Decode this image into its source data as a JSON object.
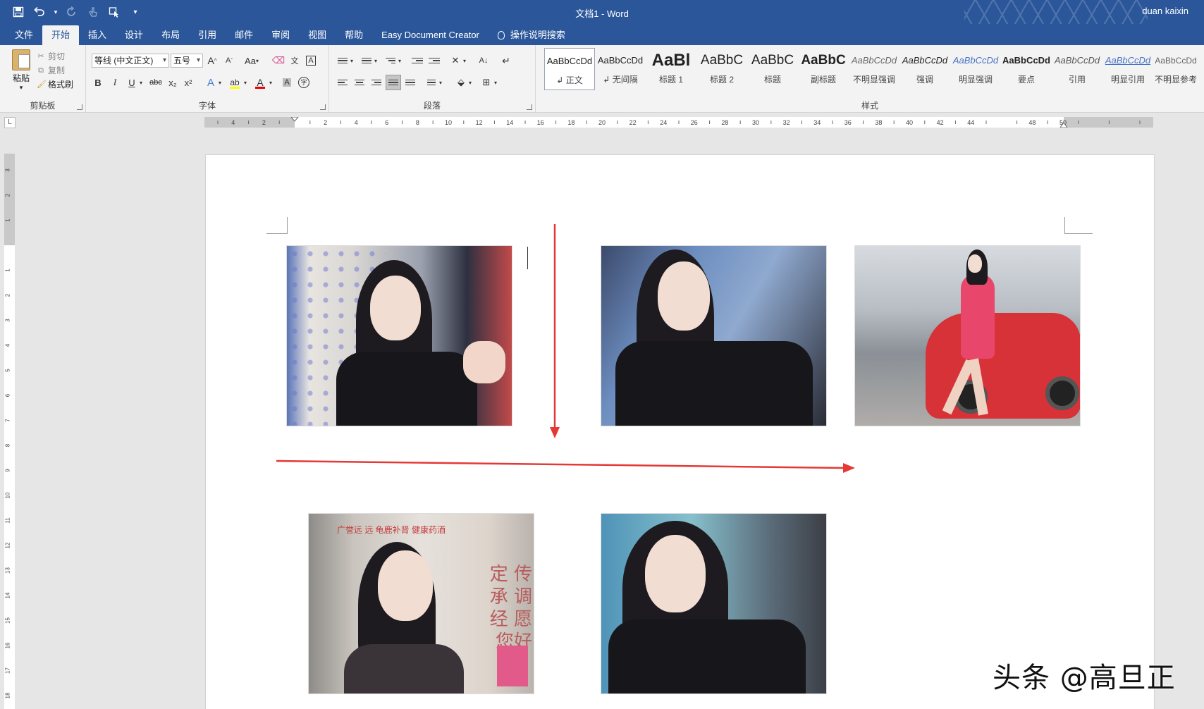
{
  "app": {
    "title": "文档1  -  Word",
    "user": "duan kaixin",
    "accent": "#2b579a"
  },
  "quick_access": {
    "icons": [
      "save-icon",
      "undo-icon",
      "redo-icon",
      "touch-mode-icon",
      "customize-qat-icon"
    ]
  },
  "tabs": [
    {
      "label": "文件"
    },
    {
      "label": "开始",
      "active": true
    },
    {
      "label": "插入"
    },
    {
      "label": "设计"
    },
    {
      "label": "布局"
    },
    {
      "label": "引用"
    },
    {
      "label": "邮件"
    },
    {
      "label": "审阅"
    },
    {
      "label": "视图"
    },
    {
      "label": "帮助"
    },
    {
      "label": "Easy Document Creator"
    },
    {
      "label": "操作说明搜索"
    }
  ],
  "ribbon": {
    "clipboard": {
      "label": "剪贴板",
      "paste": "粘贴",
      "cut": "剪切",
      "copy": "复制",
      "format_painter": "格式刷"
    },
    "font": {
      "label": "字体",
      "font_name": "等线 (中文正文)",
      "font_size": "五号",
      "grow": "A",
      "shrink": "A",
      "case": "Aa",
      "bold": "B",
      "italic": "I",
      "underline": "U",
      "strike": "abc",
      "subscript": "x₂",
      "superscript": "x²",
      "font_color": "A",
      "char_shading": "A",
      "enclose": "字"
    },
    "paragraph": {
      "label": "段落"
    },
    "styles": {
      "label": "样式",
      "items": [
        {
          "sample": "AaBbCcDd",
          "name": "正文"
        },
        {
          "sample": "AaBbCcDd",
          "name": "无间隔"
        },
        {
          "sample": "AaBl",
          "name": "标题 1"
        },
        {
          "sample": "AaBbC",
          "name": "标题 2"
        },
        {
          "sample": "AaBbC",
          "name": "标题"
        },
        {
          "sample": "AaBbC",
          "name": "副标题"
        },
        {
          "sample": "AaBbCcDd",
          "name": "不明显强调"
        },
        {
          "sample": "AaBbCcDd",
          "name": "强调"
        },
        {
          "sample": "AaBbCcDd",
          "name": "明显强调"
        },
        {
          "sample": "AaBbCcDd",
          "name": "要点"
        },
        {
          "sample": "AaBbCcDd",
          "name": "引用"
        },
        {
          "sample": "AaBbCcDd",
          "name": "明显引用"
        },
        {
          "sample": "AaBbCcDd",
          "name": "不明显参考"
        }
      ]
    }
  },
  "ruler": {
    "corner": "L",
    "left_ticks": [
      "4",
      "2"
    ],
    "ticks": [
      "2",
      "4",
      "6",
      "8",
      "10",
      "12",
      "14",
      "16",
      "18",
      "20",
      "22",
      "24",
      "26",
      "28",
      "30",
      "32",
      "34",
      "36",
      "38",
      "40",
      "42",
      "44"
    ],
    "right_ticks": [
      "48",
      "50"
    ],
    "v_top_ticks": [
      "3",
      "2",
      "1"
    ],
    "v_ticks": [
      "1",
      "2",
      "3",
      "4",
      "5",
      "6",
      "7",
      "8",
      "9",
      "10",
      "11",
      "12",
      "13",
      "14",
      "15",
      "16",
      "17",
      "18"
    ]
  },
  "document": {
    "photos": [
      {
        "name": "photo-woman-black-suit-1"
      },
      {
        "name": "photo-woman-black-suit-2"
      },
      {
        "name": "photo-woman-red-car"
      },
      {
        "name": "photo-advertisement-poster",
        "header": "广誉远  远  龟鹿补肾  健康药酒",
        "slogan": "定 传承 调经 愿您好"
      },
      {
        "name": "photo-woman-black-suit-3"
      }
    ],
    "arrow_color": "#e53935"
  },
  "watermark": "头条 @高旦正"
}
